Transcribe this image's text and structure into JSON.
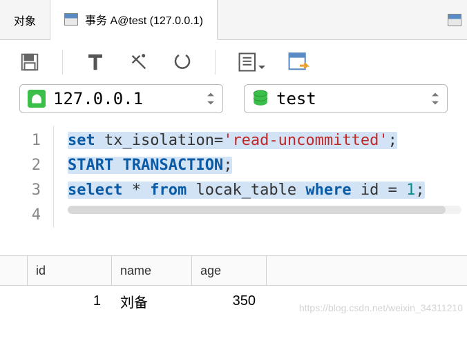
{
  "tabs": {
    "object": "对象",
    "active_label": "事务 A@test (127.0.0.1)"
  },
  "connection": {
    "host": "127.0.0.1",
    "database": "test"
  },
  "code": {
    "line1": {
      "kw1": "set",
      "mid": " tx_isolation=",
      "str": "'read-uncommitted'",
      "end": ";"
    },
    "line2": {
      "kw1": "START",
      "kw2": "TRANSACTION",
      "end": ";"
    },
    "line3": {
      "kw1": "select",
      "star": " * ",
      "kw2": "from",
      "tbl": " locak_table ",
      "kw3": "where",
      "col": " id = ",
      "num": "1",
      "end": ";"
    },
    "gutter": [
      "1",
      "2",
      "3",
      "4"
    ]
  },
  "results": {
    "columns": [
      "id",
      "name",
      "age"
    ],
    "rows": [
      {
        "id": "1",
        "name": "刘备",
        "age": "350"
      }
    ]
  },
  "watermark": "https://blog.csdn.net/weixin_34311210"
}
